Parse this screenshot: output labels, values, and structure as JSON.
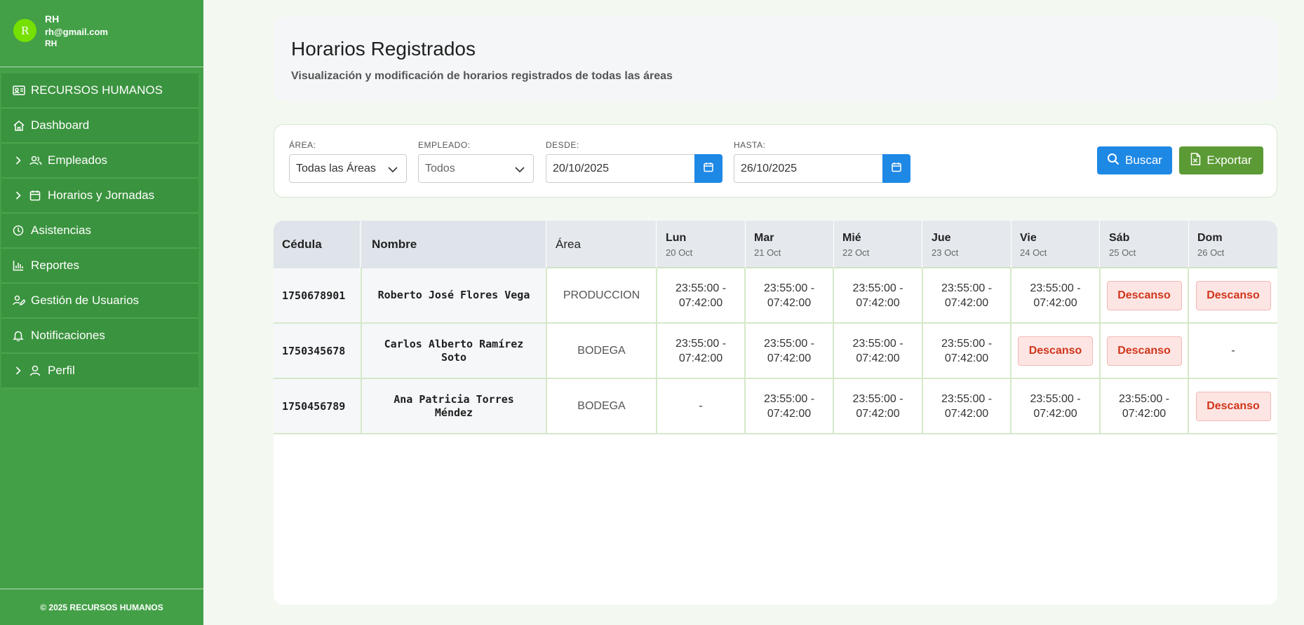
{
  "user": {
    "avatar_letter": "R",
    "name": "RH",
    "email": "rh@gmail.com",
    "role": "RH"
  },
  "sidebar": {
    "items": [
      {
        "label": "RECURSOS HUMANOS",
        "icon": "id-card-icon"
      },
      {
        "label": "Dashboard",
        "icon": "home-icon"
      },
      {
        "label": "Empleados",
        "icon": "users-icon",
        "expandable": true
      },
      {
        "label": "Horarios y Jornadas",
        "icon": "calendar-icon",
        "expandable": true
      },
      {
        "label": "Asistencias",
        "icon": "clock-icon"
      },
      {
        "label": "Reportes",
        "icon": "bar-chart-icon"
      },
      {
        "label": "Gestión de Usuarios",
        "icon": "user-edit-icon"
      },
      {
        "label": "Notificaciones",
        "icon": "bell-icon"
      },
      {
        "label": "Perfil",
        "icon": "user-icon",
        "expandable": true
      }
    ],
    "footer": "© 2025 RECURSOS HUMANOS"
  },
  "header": {
    "title": "Horarios Registrados",
    "subtitle": "Visualización y modificación de horarios registrados de todas las áreas"
  },
  "filters": {
    "area_label": "ÁREA:",
    "area_value": "Todas las Áreas",
    "employee_label": "EMPLEADO:",
    "employee_value": "Todos",
    "from_label": "DESDE:",
    "from_value": "20/10/2025",
    "to_label": "HASTA:",
    "to_value": "26/10/2025",
    "search_label": "Buscar",
    "export_label": "Exportar"
  },
  "table": {
    "headers": {
      "cedula": "Cédula",
      "nombre": "Nombre",
      "area": "Área"
    },
    "days": [
      {
        "name": "Lun",
        "date": "20 Oct"
      },
      {
        "name": "Mar",
        "date": "21 Oct"
      },
      {
        "name": "Mié",
        "date": "22 Oct"
      },
      {
        "name": "Jue",
        "date": "23 Oct"
      },
      {
        "name": "Vie",
        "date": "24 Oct"
      },
      {
        "name": "Sáb",
        "date": "25 Oct"
      },
      {
        "name": "Dom",
        "date": "26 Oct"
      }
    ],
    "rows": [
      {
        "cedula": "1750678901",
        "nombre": "Roberto José Flores Vega",
        "area": "PRODUCCION",
        "schedule": [
          "23:55:00 - 07:42:00",
          "23:55:00 - 07:42:00",
          "23:55:00 - 07:42:00",
          "23:55:00 - 07:42:00",
          "23:55:00 - 07:42:00",
          "Descanso",
          "Descanso"
        ]
      },
      {
        "cedula": "1750345678",
        "nombre": "Carlos Alberto Ramírez Soto",
        "area": "BODEGA",
        "schedule": [
          "23:55:00 - 07:42:00",
          "23:55:00 - 07:42:00",
          "23:55:00 - 07:42:00",
          "23:55:00 - 07:42:00",
          "Descanso",
          "Descanso",
          "-"
        ]
      },
      {
        "cedula": "1750456789",
        "nombre": "Ana Patricia Torres Méndez",
        "area": "BODEGA",
        "schedule": [
          "-",
          "23:55:00 - 07:42:00",
          "23:55:00 - 07:42:00",
          "23:55:00 - 07:42:00",
          "23:55:00 - 07:42:00",
          "23:55:00 - 07:42:00",
          "Descanso"
        ]
      }
    ]
  },
  "colors": {
    "sidebar": "#43a047",
    "primary": "#1e88e5",
    "export": "#5b9a34",
    "rest_text": "#d0361b"
  }
}
